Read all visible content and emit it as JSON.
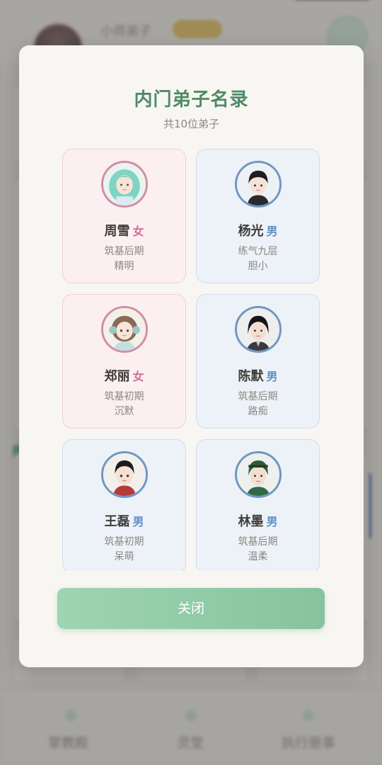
{
  "background": {
    "user_name": "小师弟子",
    "nav": [
      "掌教殿",
      "灵堂",
      "执行册事"
    ]
  },
  "modal": {
    "title": "内门弟子名录",
    "subtitle": "共10位弟子",
    "close_label": "关闭",
    "disciples": [
      {
        "name": "周雪",
        "gender": "女",
        "realm": "筑基后期",
        "trait": "精明",
        "avatar_icon": "female-portrait-icon"
      },
      {
        "name": "杨光",
        "gender": "男",
        "realm": "练气九层",
        "trait": "胆小",
        "avatar_icon": "male-portrait-icon"
      },
      {
        "name": "郑丽",
        "gender": "女",
        "realm": "筑基初期",
        "trait": "沉默",
        "avatar_icon": "female-portrait-icon"
      },
      {
        "name": "陈默",
        "gender": "男",
        "realm": "筑基后期",
        "trait": "路痴",
        "avatar_icon": "male-portrait-icon"
      },
      {
        "name": "王磊",
        "gender": "男",
        "realm": "筑基初期",
        "trait": "呆萌",
        "avatar_icon": "male-portrait-icon"
      },
      {
        "name": "林墨",
        "gender": "男",
        "realm": "筑基后期",
        "trait": "温柔",
        "avatar_icon": "male-portrait-icon"
      }
    ]
  },
  "colors": {
    "title": "#4f8a67",
    "female_accent": "#d36f93",
    "male_accent": "#5f90c4",
    "close_button": "#8fcaa6"
  }
}
